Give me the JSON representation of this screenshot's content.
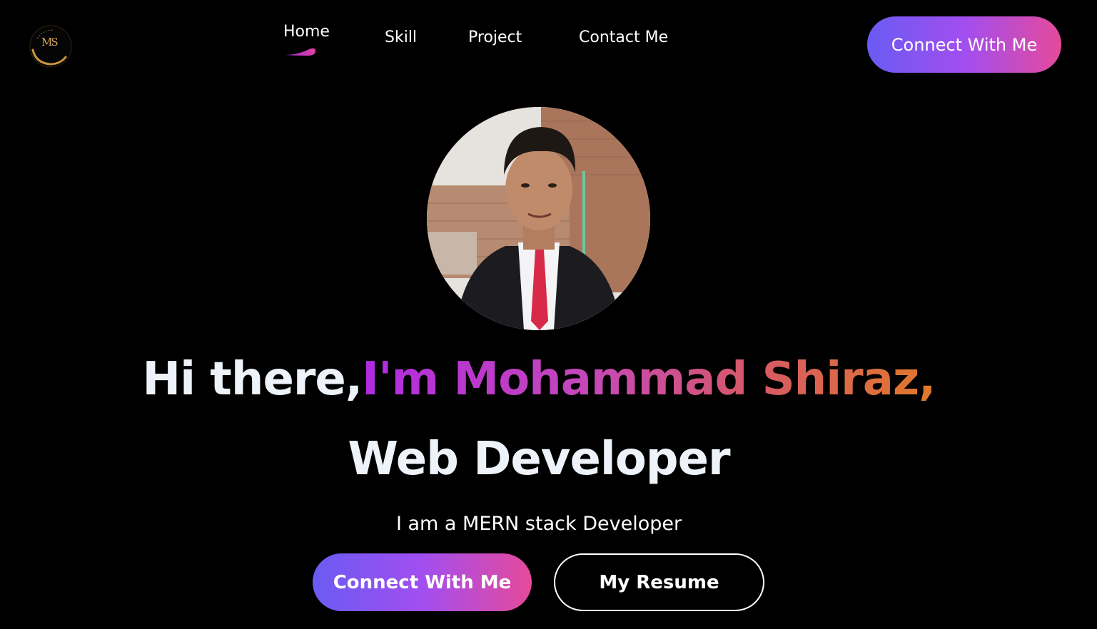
{
  "logo": {
    "monogram": "MS",
    "icon": "ms-monogram-logo"
  },
  "nav": {
    "items": [
      {
        "label": "Home",
        "active": true
      },
      {
        "label": "Skill",
        "active": false
      },
      {
        "label": "Project",
        "active": false
      },
      {
        "label": "Contact Me",
        "active": false
      }
    ]
  },
  "header_cta": {
    "label": "Connect With Me"
  },
  "hero": {
    "avatar_alt": "profile-photo",
    "greeting": "Hi there,",
    "name": "I'm Mohammad Shiraz,",
    "role": "Web Developer",
    "tagline": "I am a MERN stack Developer",
    "primary_cta": "Connect With Me",
    "secondary_cta": "My Resume"
  },
  "colors": {
    "background": "#000000",
    "gradient_start": "#6a5bf2",
    "gradient_mid": "#a24ef0",
    "gradient_end": "#e54a9a",
    "name_gradient_start": "#b02be0",
    "name_gradient_end": "#e0792a",
    "logo_gold": "#d9a85a"
  }
}
